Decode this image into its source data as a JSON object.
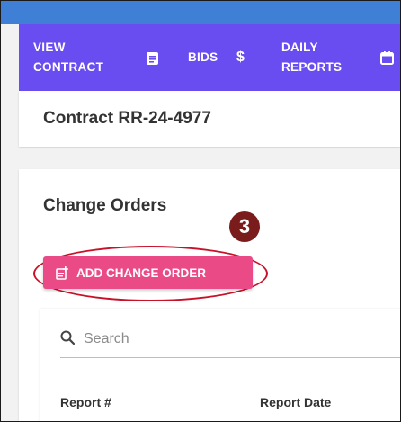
{
  "nav": {
    "view_contract": [
      "VIEW",
      "CONTRACT"
    ],
    "bids": "BIDS",
    "daily_reports": [
      "DAILY",
      "REPORTS"
    ]
  },
  "contract": {
    "title": "Contract RR-24-4977"
  },
  "change_orders": {
    "title": "Change Orders",
    "step_number": "3",
    "add_button_label": "ADD CHANGE ORDER",
    "search_placeholder": "Search",
    "columns": [
      "Report #",
      "Report Date"
    ]
  },
  "icons": {
    "view_contract": "document-icon",
    "bids": "dollar-icon",
    "daily_reports": "calendar-icon",
    "add_change_order": "add-document-icon",
    "search": "search-icon"
  },
  "colors": {
    "topstrip": "#3f7fd6",
    "navbar": "#6a4df0",
    "add_button": "#ea4b86",
    "step_badge": "#7a1c1c",
    "highlight": "#c8122a"
  }
}
